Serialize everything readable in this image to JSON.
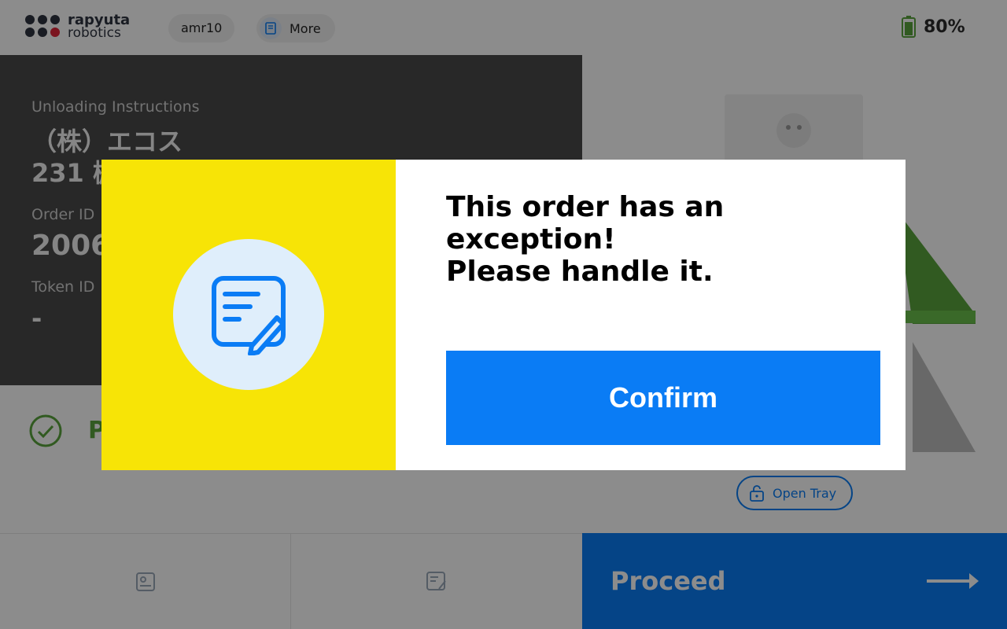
{
  "header": {
    "logo_line1": "rapyuta",
    "logo_line2": "robotics",
    "robot_name": "amr10",
    "more_label": "More",
    "battery_level": "80%",
    "battery_color": "#5aa43c"
  },
  "info": {
    "unloading_label": "Unloading Instructions",
    "customer": "（株）エコス",
    "location": "231 棚",
    "order_label": "Order ID",
    "order_value": "2006",
    "token_label": "Token ID",
    "token_value": "-"
  },
  "status": {
    "text": "P"
  },
  "right": {
    "open_tray_label": "Open Tray"
  },
  "bottom": {
    "proceed_label": "Proceed"
  },
  "modal": {
    "title_line1": "This order has an exception!",
    "title_line2": "Please handle it.",
    "confirm_label": "Confirm",
    "icon": "edit-note-icon"
  },
  "colors": {
    "accent": "#0a7cf5",
    "modal_side": "#f7e406",
    "circle_bg": "#dfeefb",
    "tray_green": "#5aa43c"
  }
}
